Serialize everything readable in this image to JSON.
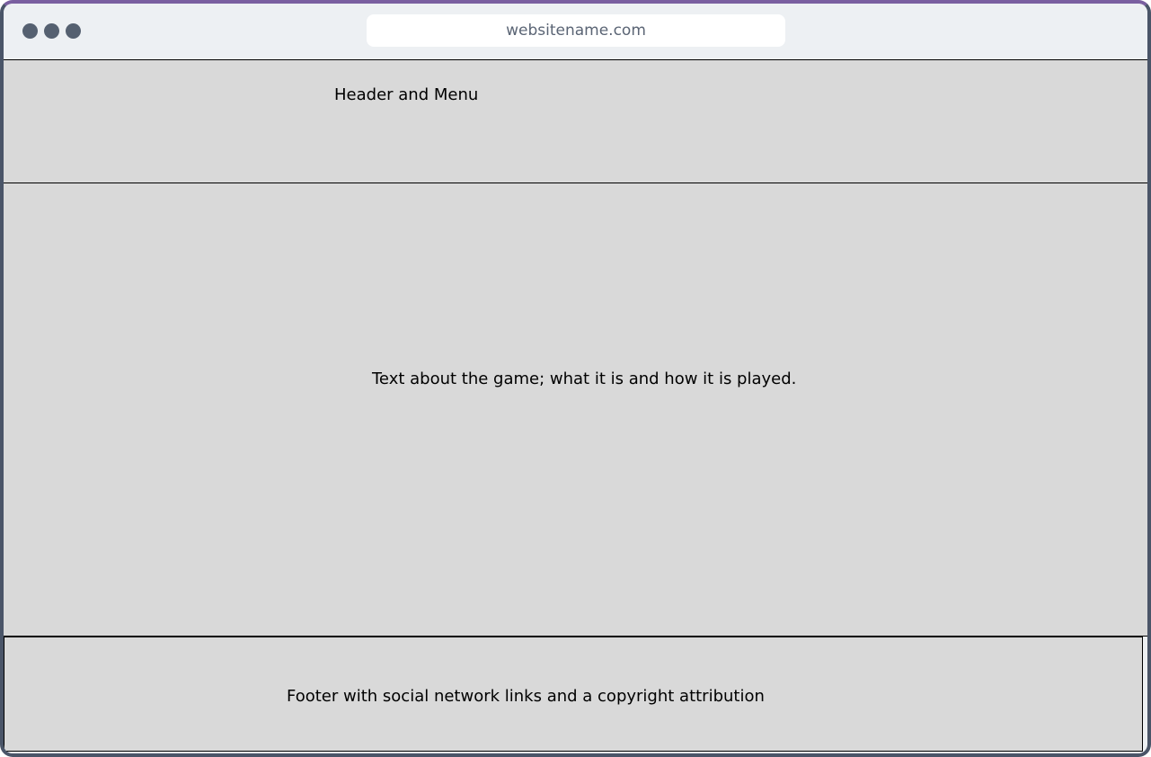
{
  "browser": {
    "url": "websitename.com",
    "window_controls": [
      "window-dot-icon",
      "window-dot-icon",
      "window-dot-icon"
    ]
  },
  "header": {
    "label": "Header and Menu"
  },
  "main": {
    "label": "Text about the game; what it is and how it is played."
  },
  "footer": {
    "label": "Footer with social network links and a copyright attribution"
  },
  "colors": {
    "section_fill": "#d9d9d9",
    "chrome_bg": "#edf0f3",
    "window_dot": "#556070",
    "frame_border": "#4a5568"
  }
}
